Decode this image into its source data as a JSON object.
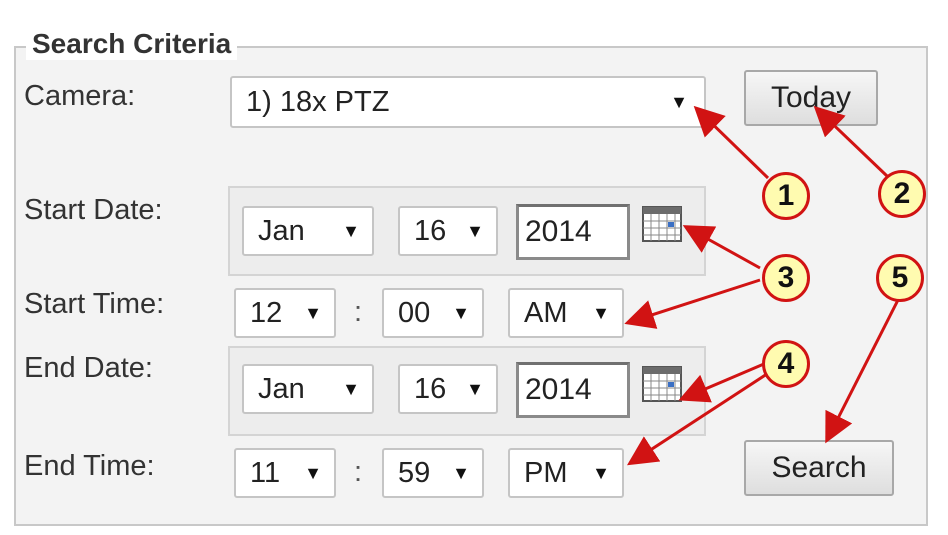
{
  "section": {
    "legend": "Search Criteria"
  },
  "labels": {
    "camera": "Camera:",
    "start_date": "Start Date:",
    "start_time": "Start Time:",
    "end_date": "End Date:",
    "end_time": "End Time:"
  },
  "camera": {
    "selected": "1) 18x PTZ"
  },
  "start_date": {
    "month": "Jan",
    "day": "16",
    "year": "2014"
  },
  "start_time": {
    "hour": "12",
    "minute": "00",
    "ampm": "AM"
  },
  "end_date": {
    "month": "Jan",
    "day": "16",
    "year": "2014"
  },
  "end_time": {
    "hour": "11",
    "minute": "59",
    "ampm": "PM"
  },
  "time_separator": ":",
  "buttons": {
    "today": "Today",
    "search": "Search"
  },
  "callouts": [
    "1",
    "2",
    "3",
    "4",
    "5"
  ],
  "icons": {
    "dropdown": "caret-down-icon",
    "calendar": "calendar-icon"
  },
  "colors": {
    "annotation": "#d11313",
    "callout_fill": "#fffbb0"
  }
}
